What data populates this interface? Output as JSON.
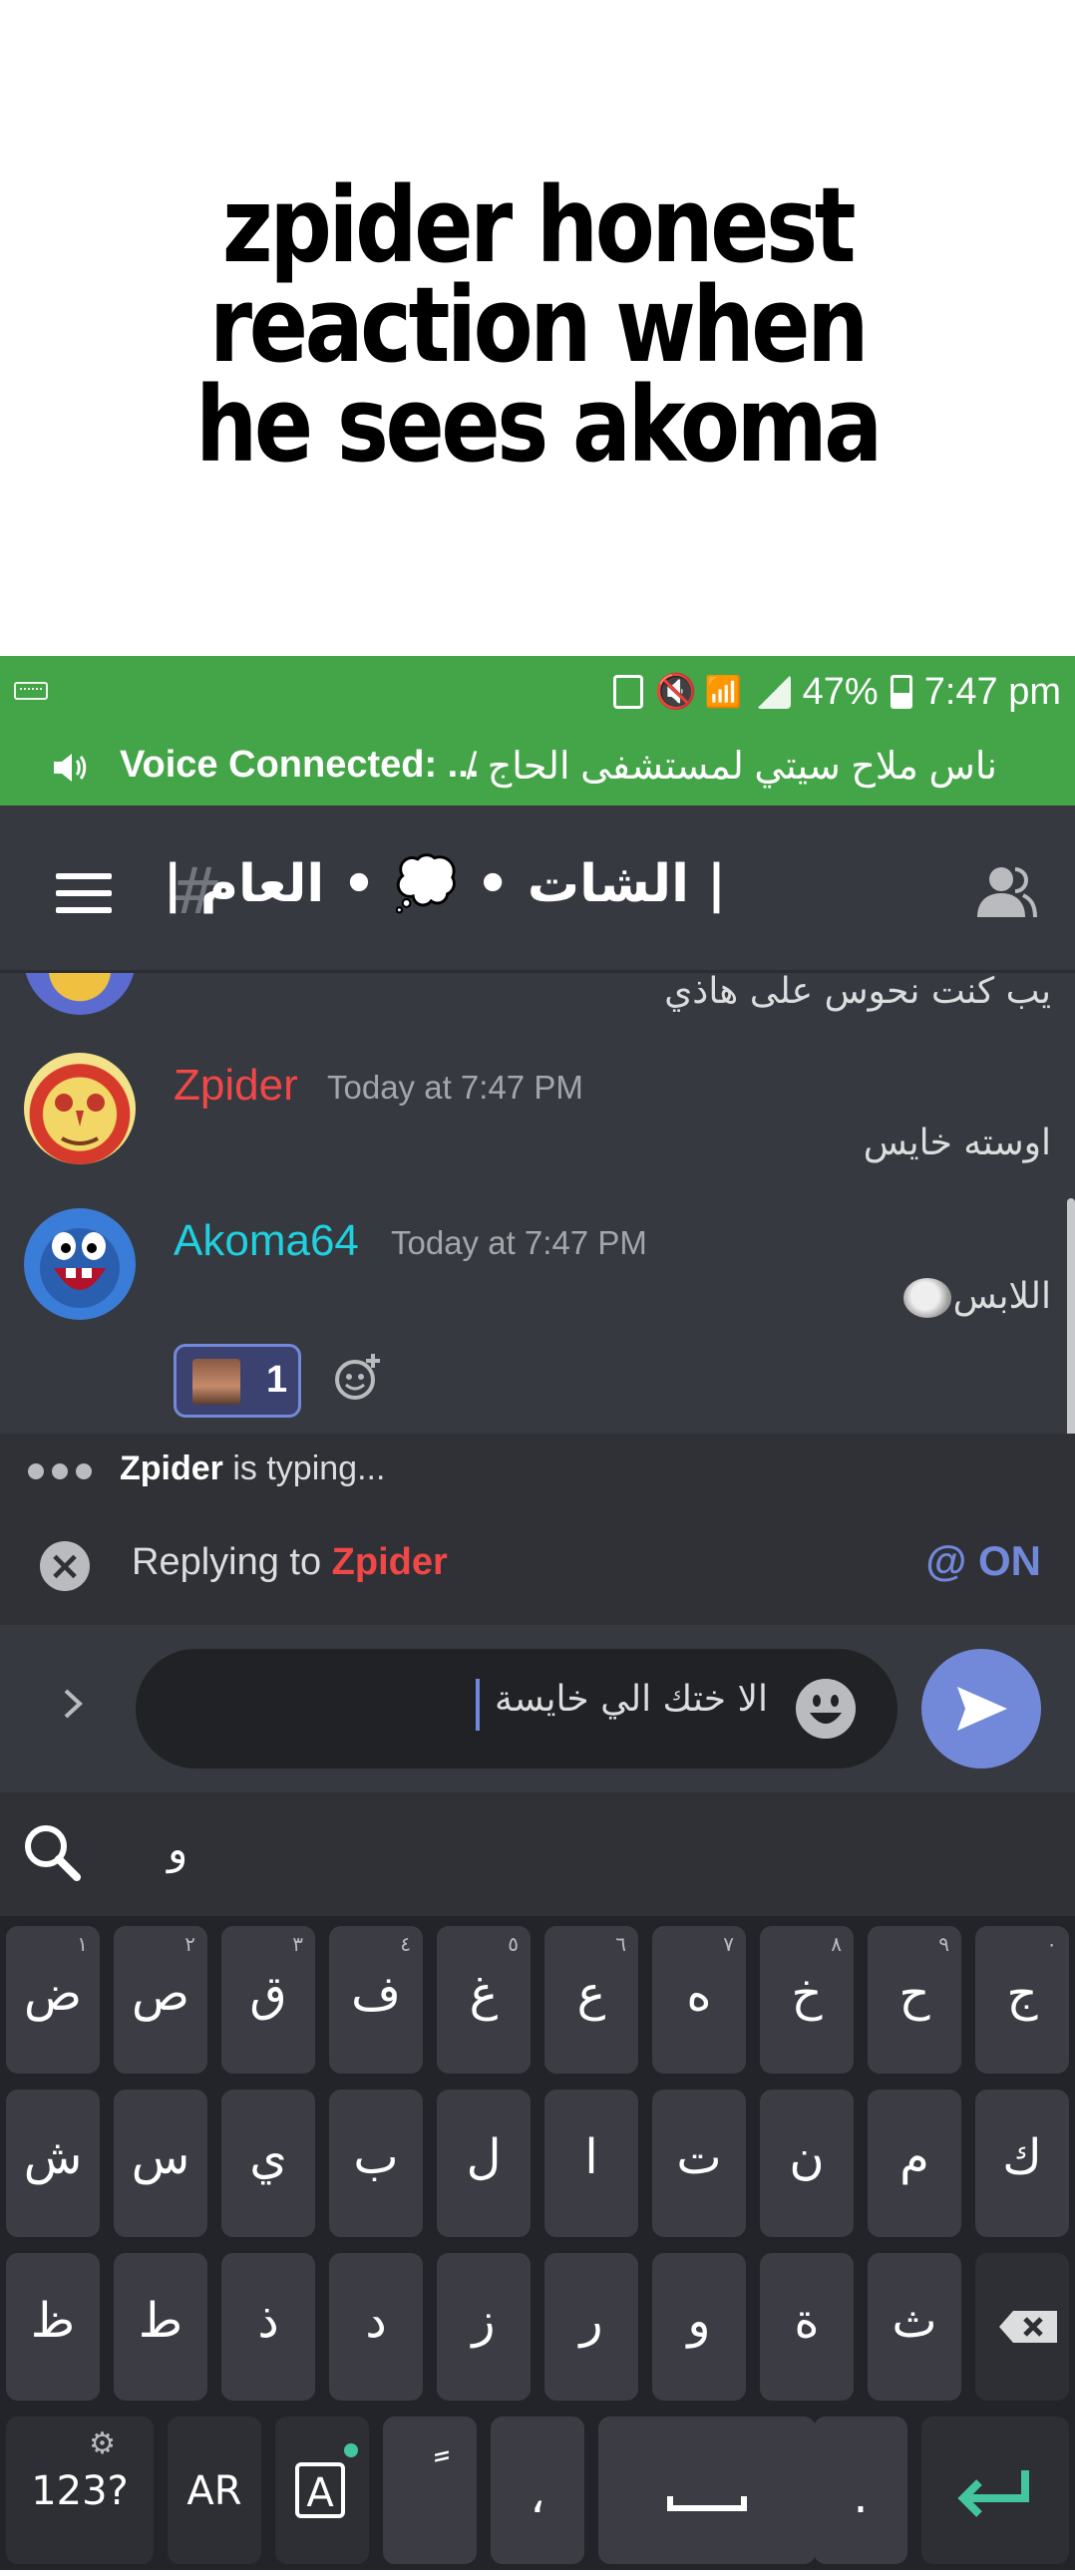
{
  "meme_caption": "zpider honest reaction when he sees akoma",
  "status_bar": {
    "battery": "47%",
    "time": "7:47 pm"
  },
  "voice_bar": {
    "label": "Voice Connected: ...",
    "channel": "ناس ملاح سيتي لمستشفى الحاج /"
  },
  "header": {
    "channel_title": "| الشات • 💭 • العام |",
    "hash_symbol": "#"
  },
  "messages": [
    {
      "text": "يب كنت نحوس على هاذي"
    },
    {
      "username": "Zpider",
      "username_color": "#f04747",
      "timestamp": "Today at 7:47 PM",
      "text": "اوسته خايس"
    },
    {
      "username": "Akoma64",
      "username_color": "#1fd1e0",
      "timestamp": "Today at 7:47 PM",
      "text": "اللابس"
    }
  ],
  "reaction": {
    "count": "1"
  },
  "typing": {
    "user": "Zpider",
    "suffix": " is typing..."
  },
  "reply": {
    "prefix": "Replying to ",
    "user": "Zpider",
    "mention": "@ ON"
  },
  "composer": {
    "value": "الا ختك الي خايسة"
  },
  "suggestion": {
    "word": "و"
  },
  "keyboard": {
    "row1": [
      {
        "key": "ض",
        "sub": "١"
      },
      {
        "key": "ص",
        "sub": "٢"
      },
      {
        "key": "ق",
        "sub": "٣"
      },
      {
        "key": "ف",
        "sub": "٤"
      },
      {
        "key": "غ",
        "sub": "٥"
      },
      {
        "key": "ع",
        "sub": "٦"
      },
      {
        "key": "ه",
        "sub": "٧"
      },
      {
        "key": "خ",
        "sub": "٨"
      },
      {
        "key": "ح",
        "sub": "٩"
      },
      {
        "key": "ج",
        "sub": "٠"
      }
    ],
    "row2": [
      "ش",
      "س",
      "ي",
      "ب",
      "ل",
      "ا",
      "ت",
      "ن",
      "م",
      "ك"
    ],
    "row3": [
      "ظ",
      "ط",
      "ذ",
      "د",
      "ز",
      "ر",
      "و",
      "ة",
      "ث"
    ],
    "bottom": {
      "numbers": "123?",
      "lang": "AR",
      "tanween": "ً",
      "comma": "،",
      "period": "."
    }
  },
  "colors": {
    "accent": "#7289da",
    "green_bar": "#43a547",
    "background": "#36393f"
  }
}
